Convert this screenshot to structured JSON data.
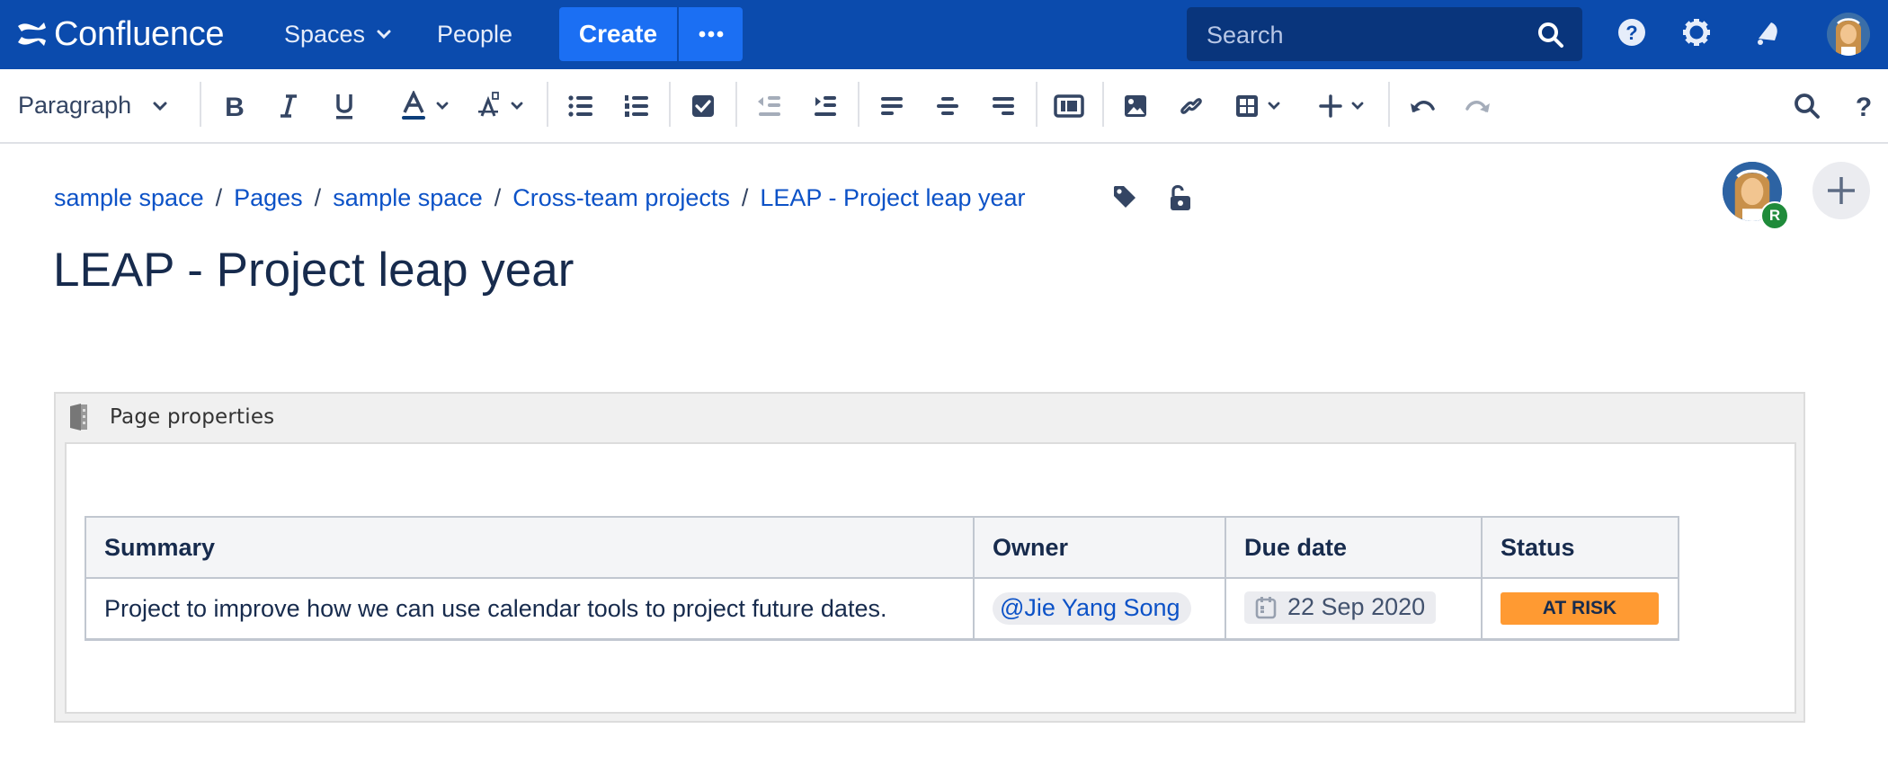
{
  "topnav": {
    "app_name": "Confluence",
    "spaces_label": "Spaces",
    "people_label": "People",
    "create_label": "Create",
    "more_label": "more-icon",
    "search_placeholder": "Search",
    "icons": [
      "help-icon",
      "settings-icon",
      "notifications-icon",
      "user-avatar"
    ],
    "brand_color": "#0b4bad",
    "create_color": "#1b6ff3"
  },
  "toolbar": {
    "paragraph_style": "Paragraph",
    "buttons": [
      "bold",
      "italic",
      "underline",
      "text-color",
      "text-style",
      "bullet-list",
      "numbered-list",
      "task-list",
      "outdent",
      "indent",
      "align-left",
      "align-center",
      "align-right",
      "page-layout",
      "insert-image",
      "insert-link",
      "insert-table",
      "insert-more",
      "undo",
      "redo",
      "find",
      "help"
    ]
  },
  "breadcrumb": [
    {
      "label": "sample space"
    },
    {
      "label": "Pages"
    },
    {
      "label": "sample space"
    },
    {
      "label": "Cross-team projects"
    },
    {
      "label": "LEAP - Project leap year"
    }
  ],
  "breadcrumb_separator": "/",
  "page": {
    "title": "LEAP - Project leap year",
    "collaborator_initial": "R"
  },
  "macro": {
    "title": "Page properties",
    "table": {
      "headers": [
        "Summary",
        "Owner",
        "Due date",
        "Status"
      ],
      "rows": [
        {
          "summary": "Project to improve how we can use calendar tools to project future dates.",
          "owner": "@Jie Yang Song",
          "due_date": "22 Sep 2020",
          "status": "AT RISK",
          "status_color": "#ff9a32"
        }
      ]
    }
  }
}
